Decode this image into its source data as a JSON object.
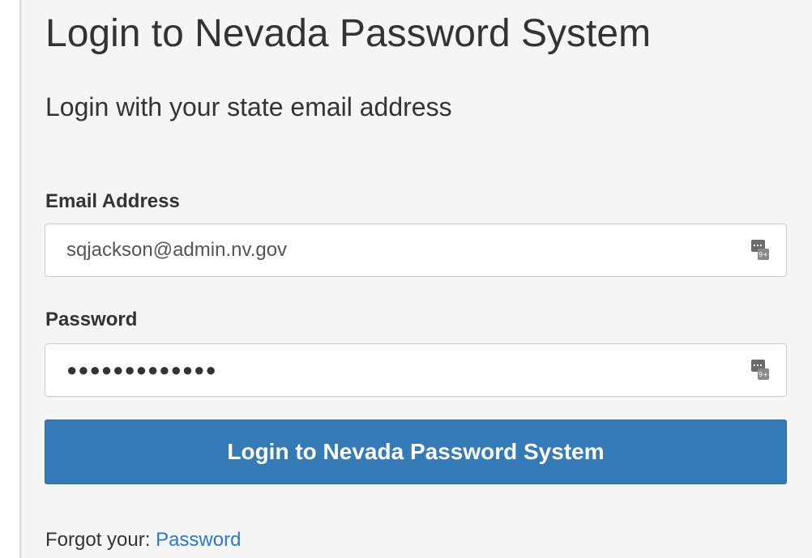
{
  "page": {
    "title": "Login to Nevada Password System",
    "subtitle": "Login with your state email address"
  },
  "form": {
    "email": {
      "label": "Email Address",
      "value": "sqjackson@admin.nv.gov",
      "icon": "password-manager-key-icon"
    },
    "password": {
      "label": "Password",
      "masked_value": "●●●●●●●●●●●●●",
      "icon": "password-manager-key-icon"
    },
    "submit_label": "Login to Nevada Password System"
  },
  "footer": {
    "forgot_prefix": "Forgot your:",
    "forgot_link": "Password"
  },
  "colors": {
    "panel_background": "#f5f5f5",
    "button_primary": "#337ab7",
    "link": "#2979d4",
    "text": "#333333"
  }
}
